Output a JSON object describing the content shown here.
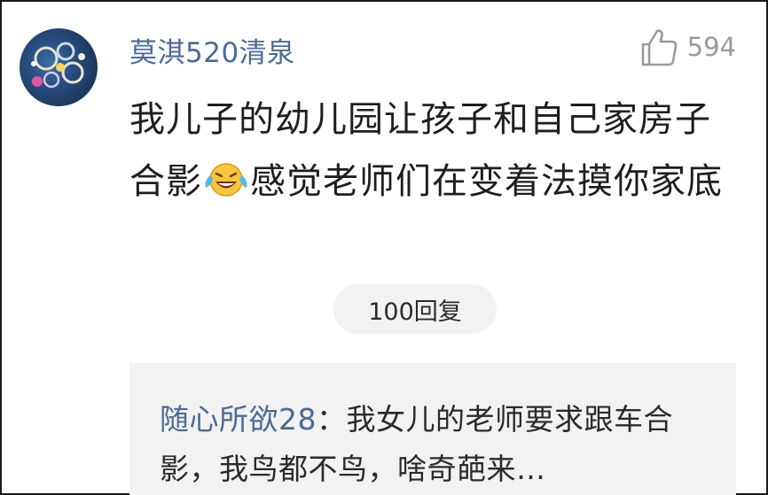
{
  "comment": {
    "username": "莫淇520清泉",
    "like_count": "594",
    "text_before_emoji": "我儿子的幼儿园让孩子和自己家房子合影",
    "text_after_emoji": "感觉老师们在变着法摸你家底",
    "emoji_icon": "laughing-crying-emoji",
    "reply_count_label": "100回复"
  },
  "reply_preview": {
    "author": "随心所欲28",
    "separator": "：",
    "text": "我女儿的老师要求跟车合影，我鸟都不鸟，啥奇葩来…"
  },
  "icons": {
    "avatar": "avatar",
    "like": "thumbs-up-icon"
  },
  "colors": {
    "username": "#4a6a94",
    "like_count": "#9a9a9a",
    "reply_box_bg": "#f2f2f2"
  }
}
